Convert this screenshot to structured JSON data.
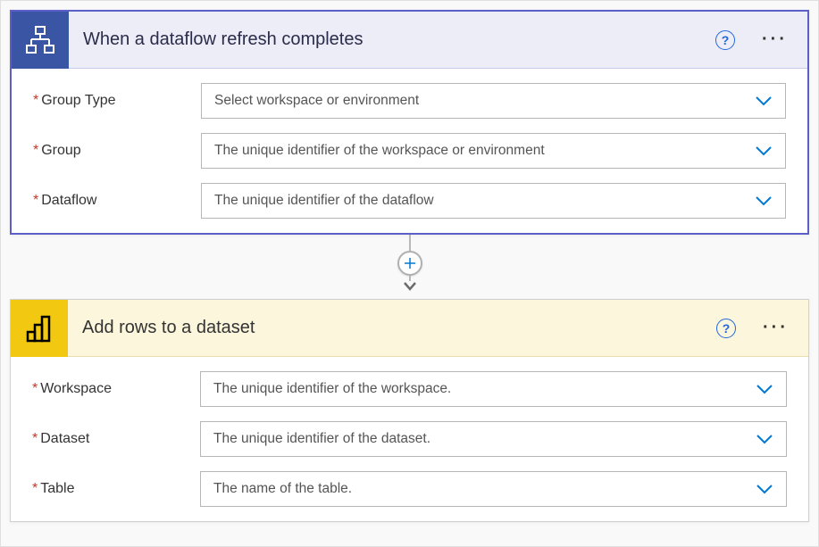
{
  "trigger": {
    "title": "When a dataflow refresh completes",
    "fields": [
      {
        "label": "Group Type",
        "placeholder": "Select workspace or environment"
      },
      {
        "label": "Group",
        "placeholder": "The unique identifier of the workspace or environment"
      },
      {
        "label": "Dataflow",
        "placeholder": "The unique identifier of the dataflow"
      }
    ]
  },
  "action": {
    "title": "Add rows to a dataset",
    "fields": [
      {
        "label": "Workspace",
        "placeholder": "The unique identifier of the workspace."
      },
      {
        "label": "Dataset",
        "placeholder": "The unique identifier of the dataset."
      },
      {
        "label": "Table",
        "placeholder": "The name of the table."
      }
    ]
  }
}
